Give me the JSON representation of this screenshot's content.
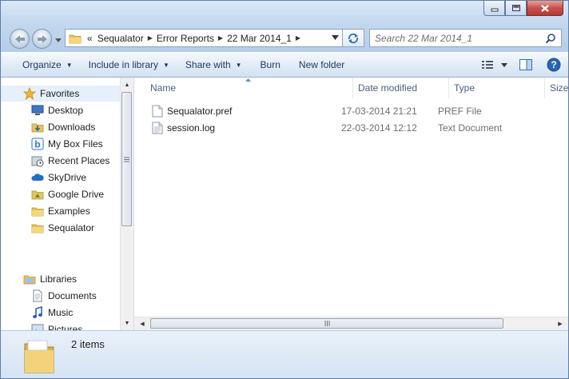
{
  "window": {
    "caption_buttons": [
      "minimize",
      "maximize",
      "close"
    ]
  },
  "address_bar": {
    "overflow": "«",
    "crumbs": [
      "Sequalator",
      "Error Reports",
      "22 Mar 2014_1"
    ]
  },
  "search": {
    "placeholder": "Search 22 Mar 2014_1"
  },
  "toolbar": {
    "organize": "Organize",
    "include_in_library": "Include in library",
    "share_with": "Share with",
    "burn": "Burn",
    "new_folder": "New folder"
  },
  "nav_pane": {
    "favorites": {
      "label": "Favorites",
      "items": [
        {
          "label": "Desktop",
          "icon": "desktop-icon"
        },
        {
          "label": "Downloads",
          "icon": "downloads-folder-icon"
        },
        {
          "label": "My Box Files",
          "icon": "box-icon"
        },
        {
          "label": "Recent Places",
          "icon": "recent-places-icon"
        },
        {
          "label": "SkyDrive",
          "icon": "skydrive-icon"
        },
        {
          "label": "Google Drive",
          "icon": "google-drive-folder-icon"
        },
        {
          "label": "Examples",
          "icon": "folder-icon"
        },
        {
          "label": "Sequalator",
          "icon": "folder-icon"
        }
      ]
    },
    "libraries": {
      "label": "Libraries",
      "items": [
        {
          "label": "Documents",
          "icon": "documents-icon"
        },
        {
          "label": "Music",
          "icon": "music-icon"
        },
        {
          "label": "Pictures",
          "icon": "pictures-icon"
        }
      ]
    }
  },
  "file_list": {
    "columns": [
      "Name",
      "Date modified",
      "Type",
      "Size"
    ],
    "rows": [
      {
        "name": "Sequalator.pref",
        "date": "17-03-2014 21:21",
        "type": "PREF File"
      },
      {
        "name": "session.log",
        "date": "22-03-2014 12:12",
        "type": "Text Document"
      }
    ]
  },
  "status_bar": {
    "item_count": "2 items"
  },
  "colors": {
    "frame": "#b6cde8",
    "accent": "#1e395b",
    "close_button": "#c75050"
  }
}
